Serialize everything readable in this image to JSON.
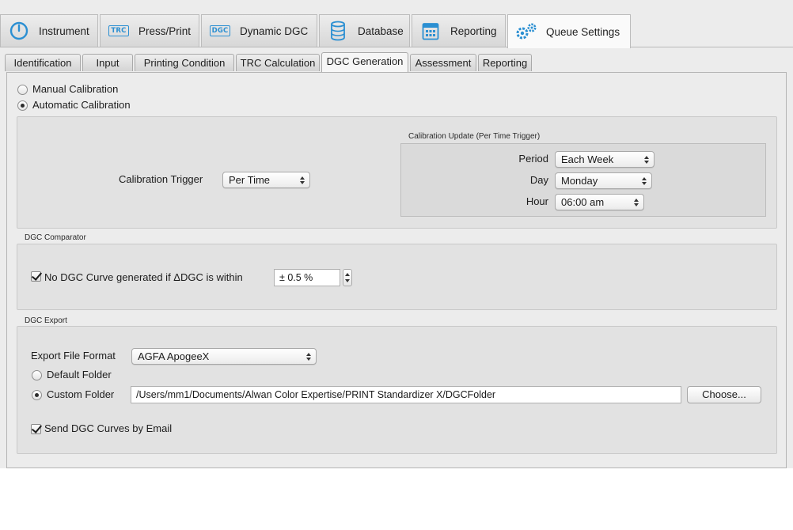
{
  "main_tabs": [
    {
      "label": "Instrument",
      "icon": "instrument-icon"
    },
    {
      "label": "Press/Print",
      "icon": "trc-icon",
      "icon_text": "TRC"
    },
    {
      "label": "Dynamic DGC",
      "icon": "dgc-icon",
      "icon_text": "DGC"
    },
    {
      "label": "Database",
      "icon": "database-icon"
    },
    {
      "label": "Reporting",
      "icon": "calendar-icon"
    },
    {
      "label": "Queue Settings",
      "icon": "gears-icon"
    }
  ],
  "active_main_tab": "Queue Settings",
  "sub_tabs": [
    "Identification",
    "Input",
    "Printing Condition",
    "TRC Calculation",
    "DGC Generation",
    "Assessment",
    "Reporting"
  ],
  "active_sub_tab": "DGC Generation",
  "calibration_mode": {
    "manual_label": "Manual Calibration",
    "automatic_label": "Automatic Calibration",
    "selected": "Automatic Calibration"
  },
  "calibration": {
    "trigger_label": "Calibration Trigger",
    "trigger_value": "Per Time",
    "update_title": "Calibration Update (Per Time Trigger)",
    "period_label": "Period",
    "period_value": "Each Week",
    "day_label": "Day",
    "day_value": "Monday",
    "hour_label": "Hour",
    "hour_value": "06:00 am"
  },
  "comparator": {
    "title": "DGC Comparator",
    "checkbox_label": "No DGC Curve generated if ΔDGC is within",
    "checked": true,
    "value": "± 0.5 %"
  },
  "export": {
    "title": "DGC Export",
    "format_label": "Export File Format",
    "format_value": "AGFA ApogeeX",
    "default_folder_label": "Default Folder",
    "custom_folder_label": "Custom Folder",
    "selected_folder_option": "Custom Folder",
    "custom_folder_path": "/Users/mm1/Documents/Alwan Color Expertise/PRINT Standardizer X/DGCFolder",
    "choose_button": "Choose...",
    "email_label": "Send DGC Curves by Email",
    "email_checked": true
  },
  "colors": {
    "accent": "#2b8fd2",
    "window_bg": "#ececec",
    "group_bg": "#e2e2e2"
  }
}
